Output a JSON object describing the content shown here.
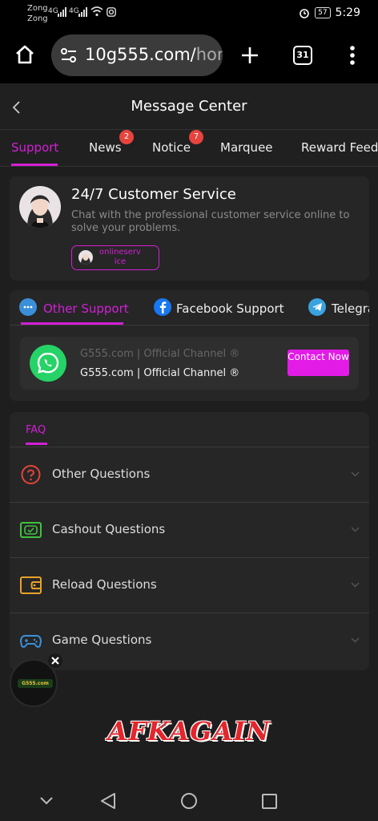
{
  "status_bar": {
    "carrier1": "Zong",
    "carrier2": "Zong",
    "network1": "4G",
    "network2": "4G",
    "battery": "57",
    "time": "5:29"
  },
  "browser": {
    "url_main": "10g555.com/",
    "url_rest": "hom",
    "tab_count": "31"
  },
  "header": {
    "title": "Message Center"
  },
  "tabs": [
    {
      "label": "Support",
      "badge": ""
    },
    {
      "label": "News",
      "badge": "2"
    },
    {
      "label": "Notice",
      "badge": "7"
    },
    {
      "label": "Marquee",
      "badge": ""
    },
    {
      "label": "Reward Feed",
      "badge": ""
    }
  ],
  "customer_service": {
    "title": "24/7 Customer Service",
    "description": "Chat with the professional customer service online to solve your problems.",
    "pill_label": "onlineservice"
  },
  "support_tabs": [
    {
      "label": "Other Support",
      "icon": "chat-bubbles-icon"
    },
    {
      "label": "Facebook Support",
      "icon": "facebook-icon"
    },
    {
      "label": "Telegra",
      "icon": "telegram-icon"
    }
  ],
  "channel": {
    "name_dim": "G555.com | Official Channel ®",
    "name": "G555.com | Official Channel ®",
    "button": "Contact Now"
  },
  "faq": {
    "tab": "FAQ",
    "items": [
      {
        "label": "Other Questions",
        "icon": "question-circle-icon",
        "color": "#e2453a"
      },
      {
        "label": "Cashout Questions",
        "icon": "cash-icon",
        "color": "#3fc23f"
      },
      {
        "label": "Reload Questions",
        "icon": "wallet-icon",
        "color": "#e8a22a"
      },
      {
        "label": "Game Questions",
        "icon": "gamepad-icon",
        "color": "#3b8fd8"
      }
    ]
  },
  "floating": {
    "logo_text": "G555.com"
  },
  "watermark": "AFKAGAIN",
  "colors": {
    "accent": "#d31fd6",
    "badge": "#e6443c",
    "background": "#1e1e1e",
    "card": "#262626"
  }
}
